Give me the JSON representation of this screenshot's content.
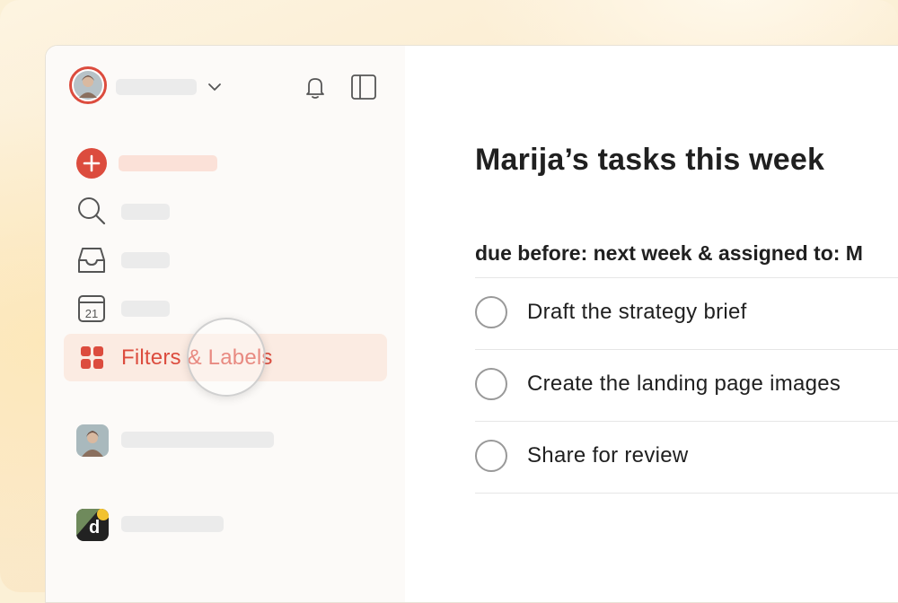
{
  "sidebar": {
    "nav": {
      "filters_labels": "Filters & Labels"
    },
    "icons": {
      "add": "plus-circle-icon",
      "search": "search-icon",
      "inbox": "inbox-icon",
      "calendar": "calendar-icon",
      "calendar_day": "21",
      "filters": "grid-icon",
      "notifications": "bell-icon",
      "toggle_sidebar": "sidebar-toggle-icon"
    }
  },
  "main": {
    "title": "Marija’s tasks this week",
    "filter_query": "due before: next week & assigned to: M",
    "tasks": [
      {
        "label": "Draft the strategy brief"
      },
      {
        "label": "Create the landing page images"
      },
      {
        "label": "Share for review"
      }
    ]
  },
  "colors": {
    "accent": "#dc4c3e",
    "highlight_bg": "#fbebe2",
    "sidebar_bg": "#fcfaf8"
  }
}
